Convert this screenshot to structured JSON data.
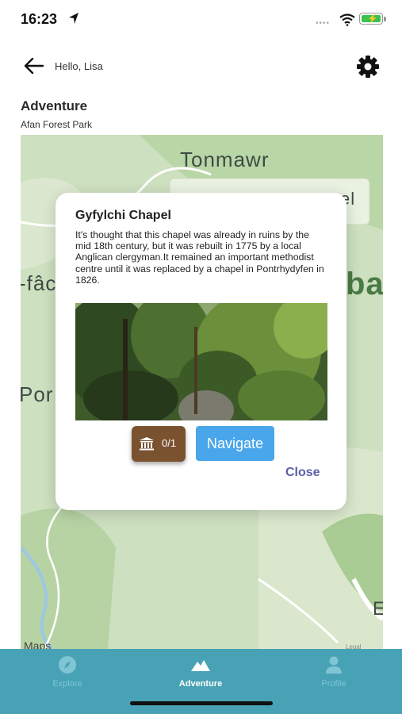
{
  "status_bar": {
    "time": "16:23"
  },
  "header": {
    "greeting": "Hello,  Lisa",
    "title": "Adventure",
    "subtitle": "Afan Forest Park"
  },
  "map": {
    "labels": {
      "tonmawr": "Tonmawr",
      "chapel_fragment": "el",
      "left_fragment": "-fâc",
      "pon_fragment": "Por",
      "ba_fragment": "ba",
      "e_fragment": "E"
    },
    "attribution": "Maps",
    "legal": "Legal"
  },
  "dialog": {
    "title": "Gyfylchi Chapel",
    "description": "It's thought that this chapel was already in ruins by the mid 18th century, but it was rebuilt in 1775 by a local Anglican clergyman.It remained an important methodist centre until it was replaced by a chapel in Pontrhydyfen in 1826.",
    "visit_count": "0/1",
    "navigate_label": "Navigate",
    "close_label": "Close",
    "colors": {
      "badge": "#7a5230",
      "navigate": "#4aa6ea",
      "close": "#5e5ea8"
    }
  },
  "tabbar": {
    "background": "#47a2b5",
    "tabs": [
      {
        "label": "Explore",
        "icon": "compass-icon"
      },
      {
        "label": "Adventure",
        "icon": "mountain-icon"
      },
      {
        "label": "Profile",
        "icon": "person-icon"
      }
    ]
  }
}
